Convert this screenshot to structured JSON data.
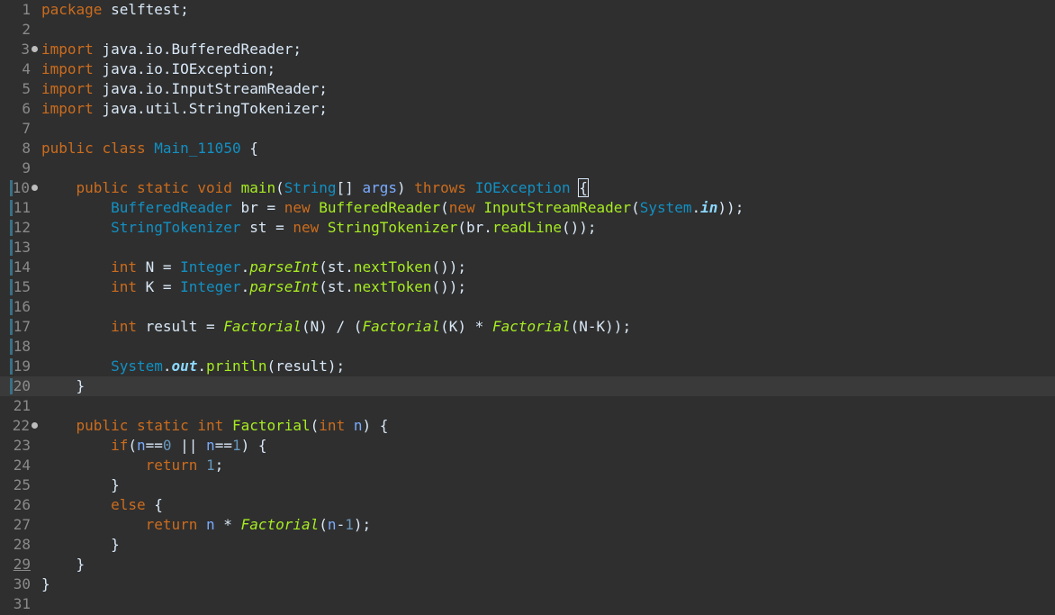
{
  "editor": {
    "language": "java",
    "current_line": 20,
    "lines": [
      {
        "n": "1",
        "tokens": [
          [
            "kw",
            "package"
          ],
          [
            "txt",
            " selftest;"
          ]
        ]
      },
      {
        "n": "2",
        "tokens": []
      },
      {
        "n": "3",
        "fold": true,
        "tokens": [
          [
            "kw",
            "import"
          ],
          [
            "txt",
            " java.io.BufferedReader;"
          ]
        ]
      },
      {
        "n": "4",
        "tokens": [
          [
            "kw",
            "import"
          ],
          [
            "txt",
            " java.io.IOException;"
          ]
        ]
      },
      {
        "n": "5",
        "tokens": [
          [
            "kw",
            "import"
          ],
          [
            "txt",
            " java.io.InputStreamReader;"
          ]
        ]
      },
      {
        "n": "6",
        "tokens": [
          [
            "kw",
            "import"
          ],
          [
            "txt",
            " java.util.StringTokenizer;"
          ]
        ]
      },
      {
        "n": "7",
        "tokens": []
      },
      {
        "n": "8",
        "tokens": [
          [
            "kw",
            "public"
          ],
          [
            "txt",
            " "
          ],
          [
            "kw",
            "class"
          ],
          [
            "txt",
            " "
          ],
          [
            "typ",
            "Main_11050"
          ],
          [
            "txt",
            " {"
          ]
        ]
      },
      {
        "n": "9",
        "tokens": []
      },
      {
        "n": "10",
        "fold": true,
        "marker": true,
        "tokens": [
          [
            "txt",
            "    "
          ],
          [
            "kw",
            "public"
          ],
          [
            "txt",
            " "
          ],
          [
            "kw",
            "static"
          ],
          [
            "txt",
            " "
          ],
          [
            "kw",
            "void"
          ],
          [
            "txt",
            " "
          ],
          [
            "fn",
            "main"
          ],
          [
            "txt",
            "("
          ],
          [
            "typ",
            "String"
          ],
          [
            "txt",
            "[] "
          ],
          [
            "var",
            "args"
          ],
          [
            "txt",
            ") "
          ],
          [
            "kw",
            "throws"
          ],
          [
            "txt",
            " "
          ],
          [
            "typ",
            "IOException"
          ],
          [
            "txt",
            " "
          ],
          [
            "box",
            "{"
          ]
        ]
      },
      {
        "n": "11",
        "marker": true,
        "tokens": [
          [
            "txt",
            "        "
          ],
          [
            "typ",
            "BufferedReader"
          ],
          [
            "txt",
            " br = "
          ],
          [
            "kw",
            "new"
          ],
          [
            "txt",
            " "
          ],
          [
            "fn",
            "BufferedReader"
          ],
          [
            "txt",
            "("
          ],
          [
            "kw",
            "new"
          ],
          [
            "txt",
            " "
          ],
          [
            "fn",
            "InputStreamReader"
          ],
          [
            "txt",
            "("
          ],
          [
            "typ",
            "System"
          ],
          [
            "txt",
            "."
          ],
          [
            "fld",
            "in"
          ],
          [
            "txt",
            "));"
          ]
        ]
      },
      {
        "n": "12",
        "marker": true,
        "tokens": [
          [
            "txt",
            "        "
          ],
          [
            "typ",
            "StringTokenizer"
          ],
          [
            "txt",
            " st = "
          ],
          [
            "kw",
            "new"
          ],
          [
            "txt",
            " "
          ],
          [
            "fn",
            "StringTokenizer"
          ],
          [
            "txt",
            "(br."
          ],
          [
            "fn",
            "readLine"
          ],
          [
            "txt",
            "());"
          ]
        ]
      },
      {
        "n": "13",
        "marker": true,
        "tokens": []
      },
      {
        "n": "14",
        "marker": true,
        "tokens": [
          [
            "txt",
            "        "
          ],
          [
            "kw",
            "int"
          ],
          [
            "txt",
            " N = "
          ],
          [
            "typ",
            "Integer"
          ],
          [
            "txt",
            "."
          ],
          [
            "sfn",
            "parseInt"
          ],
          [
            "txt",
            "(st."
          ],
          [
            "fn",
            "nextToken"
          ],
          [
            "txt",
            "());"
          ]
        ]
      },
      {
        "n": "15",
        "marker": true,
        "tokens": [
          [
            "txt",
            "        "
          ],
          [
            "kw",
            "int"
          ],
          [
            "txt",
            " K = "
          ],
          [
            "typ",
            "Integer"
          ],
          [
            "txt",
            "."
          ],
          [
            "sfn",
            "parseInt"
          ],
          [
            "txt",
            "(st."
          ],
          [
            "fn",
            "nextToken"
          ],
          [
            "txt",
            "());"
          ]
        ]
      },
      {
        "n": "16",
        "marker": true,
        "tokens": []
      },
      {
        "n": "17",
        "marker": true,
        "tokens": [
          [
            "txt",
            "        "
          ],
          [
            "kw",
            "int"
          ],
          [
            "txt",
            " result = "
          ],
          [
            "sfn",
            "Factorial"
          ],
          [
            "txt",
            "(N) / ("
          ],
          [
            "sfn",
            "Factorial"
          ],
          [
            "txt",
            "(K) * "
          ],
          [
            "sfn",
            "Factorial"
          ],
          [
            "txt",
            "(N-K));"
          ]
        ]
      },
      {
        "n": "18",
        "marker": true,
        "tokens": []
      },
      {
        "n": "19",
        "marker": true,
        "tokens": [
          [
            "txt",
            "        "
          ],
          [
            "typ",
            "System"
          ],
          [
            "txt",
            "."
          ],
          [
            "fld",
            "out"
          ],
          [
            "txt",
            "."
          ],
          [
            "fn",
            "println"
          ],
          [
            "txt",
            "(result);"
          ]
        ]
      },
      {
        "n": "20",
        "marker": true,
        "tokens": [
          [
            "txt",
            "    }"
          ]
        ]
      },
      {
        "n": "21",
        "tokens": []
      },
      {
        "n": "22",
        "fold": true,
        "tokens": [
          [
            "txt",
            "    "
          ],
          [
            "kw",
            "public"
          ],
          [
            "txt",
            " "
          ],
          [
            "kw",
            "static"
          ],
          [
            "txt",
            " "
          ],
          [
            "kw",
            "int"
          ],
          [
            "txt",
            " "
          ],
          [
            "fn",
            "Factorial"
          ],
          [
            "txt",
            "("
          ],
          [
            "kw",
            "int"
          ],
          [
            "txt",
            " "
          ],
          [
            "var",
            "n"
          ],
          [
            "txt",
            ") {"
          ]
        ]
      },
      {
        "n": "23",
        "tokens": [
          [
            "txt",
            "        "
          ],
          [
            "kw",
            "if"
          ],
          [
            "txt",
            "("
          ],
          [
            "var",
            "n"
          ],
          [
            "txt",
            "=="
          ],
          [
            "num",
            "0"
          ],
          [
            "txt",
            " || "
          ],
          [
            "var",
            "n"
          ],
          [
            "txt",
            "=="
          ],
          [
            "num",
            "1"
          ],
          [
            "txt",
            ") {"
          ]
        ]
      },
      {
        "n": "24",
        "tokens": [
          [
            "txt",
            "            "
          ],
          [
            "kw",
            "return"
          ],
          [
            "txt",
            " "
          ],
          [
            "num",
            "1"
          ],
          [
            "txt",
            ";"
          ]
        ]
      },
      {
        "n": "25",
        "tokens": [
          [
            "txt",
            "        }"
          ]
        ]
      },
      {
        "n": "26",
        "tokens": [
          [
            "txt",
            "        "
          ],
          [
            "kw",
            "else"
          ],
          [
            "txt",
            " {"
          ]
        ]
      },
      {
        "n": "27",
        "tokens": [
          [
            "txt",
            "            "
          ],
          [
            "kw",
            "return"
          ],
          [
            "txt",
            " "
          ],
          [
            "var",
            "n"
          ],
          [
            "txt",
            " * "
          ],
          [
            "sfn",
            "Factorial"
          ],
          [
            "txt",
            "("
          ],
          [
            "var",
            "n"
          ],
          [
            "txt",
            "-"
          ],
          [
            "num",
            "1"
          ],
          [
            "txt",
            ");"
          ]
        ]
      },
      {
        "n": "28",
        "tokens": [
          [
            "txt",
            "        }"
          ]
        ]
      },
      {
        "n": "29",
        "underline": true,
        "tokens": [
          [
            "txt",
            "    }"
          ]
        ]
      },
      {
        "n": "30",
        "tokens": [
          [
            "txt",
            "}"
          ]
        ]
      },
      {
        "n": "31",
        "tokens": []
      }
    ]
  },
  "colors": {
    "background": "#2f2f2f",
    "current_line": "#3a3a3a",
    "keyword": "#cc6c1d",
    "type": "#1290c3",
    "method": "#a7ec21",
    "variable": "#79abff",
    "number": "#6897bb",
    "text": "#d9e8f7"
  }
}
